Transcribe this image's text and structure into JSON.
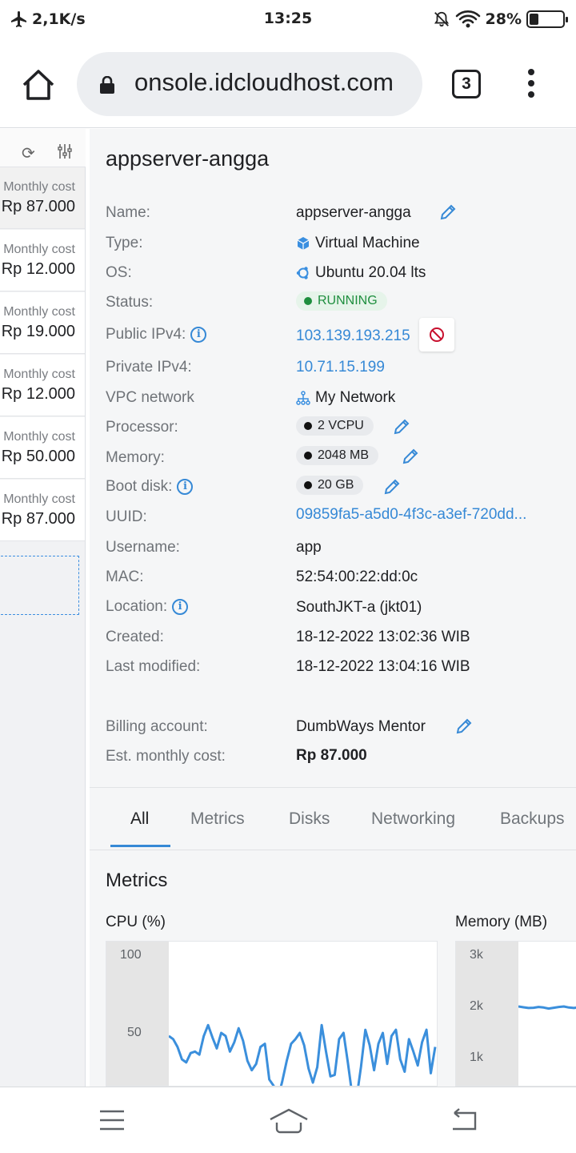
{
  "status_bar": {
    "speed": "2,1K/s",
    "time": "13:25",
    "battery": "28%",
    "battery_level": 0.28
  },
  "browser": {
    "url": "onsole.idcloudhost.com",
    "tab_count": "3"
  },
  "sidebar": {
    "cards": [
      {
        "label": "Monthly cost",
        "value": "Rp 87.000"
      },
      {
        "label": "Monthly cost",
        "value": "Rp 12.000"
      },
      {
        "label": "Monthly cost",
        "value": "Rp 19.000"
      },
      {
        "label": "Monthly cost",
        "value": "Rp 12.000"
      },
      {
        "label": "Monthly cost",
        "value": "Rp 50.000"
      },
      {
        "label": "Monthly cost",
        "value": "Rp 87.000"
      }
    ]
  },
  "server": {
    "title": "appserver-angga",
    "fields": {
      "name": {
        "label": "Name:",
        "value": "appserver-angga"
      },
      "type": {
        "label": "Type:",
        "value": "Virtual Machine"
      },
      "os": {
        "label": "OS:",
        "value": "Ubuntu 20.04 lts"
      },
      "status": {
        "label": "Status:",
        "value": "RUNNING"
      },
      "public_ip": {
        "label": "Public IPv4:",
        "value": "103.139.193.215"
      },
      "private_ip": {
        "label": "Private IPv4:",
        "value": "10.71.15.199"
      },
      "vpc": {
        "label": "VPC network",
        "value": "My Network"
      },
      "processor": {
        "label": "Processor:",
        "value": "2 VCPU"
      },
      "memory": {
        "label": "Memory:",
        "value": "2048 MB"
      },
      "boot_disk": {
        "label": "Boot disk:",
        "value": "20 GB"
      },
      "uuid": {
        "label": "UUID:",
        "value": "09859fa5-a5d0-4f3c-a3ef-720dd..."
      },
      "username": {
        "label": "Username:",
        "value": "app"
      },
      "mac": {
        "label": "MAC:",
        "value": "52:54:00:22:dd:0c"
      },
      "location": {
        "label": "Location:",
        "value": "SouthJKT-a (jkt01)"
      },
      "created": {
        "label": "Created:",
        "value": "18-12-2022 13:02:36 WIB"
      },
      "modified": {
        "label": "Last modified:",
        "value": "18-12-2022 13:04:16 WIB"
      },
      "billing": {
        "label": "Billing account:",
        "value": "DumbWays Mentor"
      },
      "cost": {
        "label": "Est. monthly cost:",
        "value": "Rp 87.000"
      }
    }
  },
  "tabs": [
    "All",
    "Metrics",
    "Disks",
    "Networking",
    "Backups"
  ],
  "metrics": {
    "title": "Metrics"
  },
  "colors": {
    "accent": "#3689d6",
    "running": "#1e8e3e",
    "line": "#3b8fdc"
  },
  "chart_data": [
    {
      "type": "line",
      "title": "CPU (%)",
      "ylim": [
        0,
        100
      ],
      "yticks": [
        "100",
        "50"
      ],
      "series": [
        {
          "values": [
            48,
            46,
            41,
            33,
            31,
            37,
            38,
            36,
            48,
            55,
            47,
            40,
            50,
            48,
            38,
            44,
            53,
            45,
            32,
            26,
            30,
            41,
            43,
            20,
            16,
            8,
            19,
            32,
            43,
            46,
            50,
            42,
            27,
            18,
            28,
            55,
            38,
            22,
            23,
            46,
            50,
            31,
            10,
            8,
            28,
            52,
            42,
            26,
            43,
            50,
            30,
            48,
            52,
            33,
            25,
            46,
            38,
            29,
            44,
            52,
            24,
            41
          ]
        }
      ]
    },
    {
      "type": "line",
      "title": "Memory (MB)",
      "ylim": [
        0,
        3000
      ],
      "yticks": [
        "3k",
        "2k",
        "1k"
      ],
      "series": [
        {
          "values": [
            2000,
            1985,
            1970,
            1975,
            1990,
            1980,
            1960,
            1975,
            1990,
            2000,
            1980,
            1970,
            1985,
            1990
          ]
        }
      ]
    }
  ]
}
